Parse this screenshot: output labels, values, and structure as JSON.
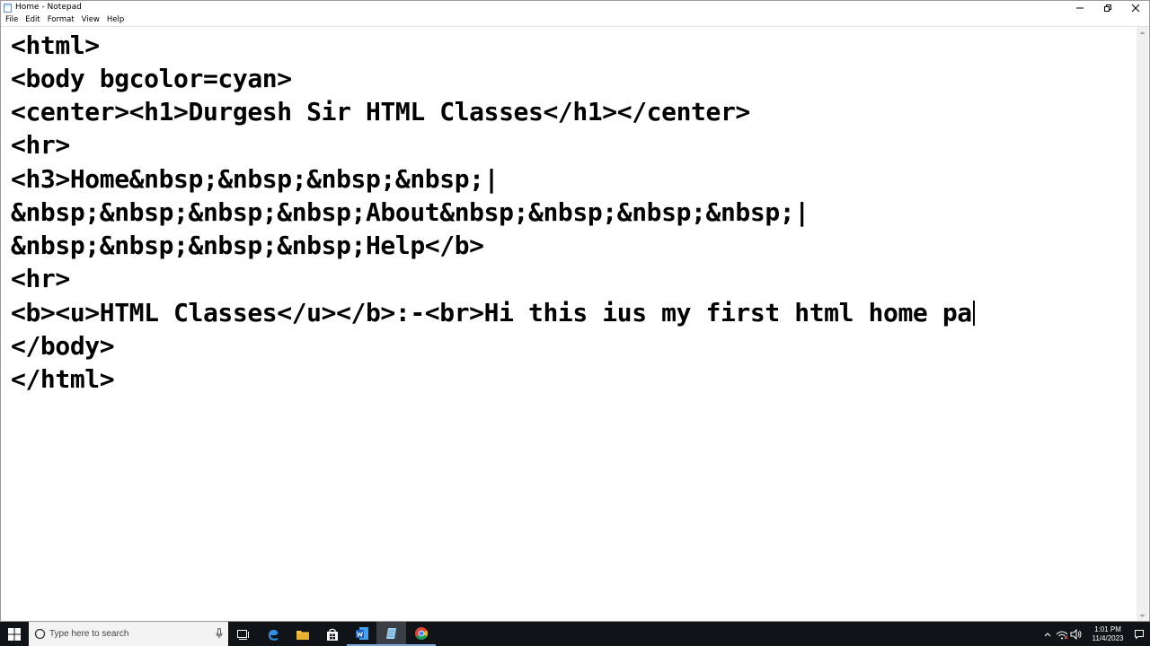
{
  "window": {
    "title": "Home - Notepad"
  },
  "menu": {
    "items": [
      "File",
      "Edit",
      "Format",
      "View",
      "Help"
    ]
  },
  "editor": {
    "lines": [
      "<html>",
      "<body bgcolor=cyan>",
      "<center><h1>Durgesh Sir HTML Classes</h1></center>",
      "<hr>",
      "<h3>Home&nbsp;&nbsp;&nbsp;&nbsp;|",
      "&nbsp;&nbsp;&nbsp;&nbsp;About&nbsp;&nbsp;&nbsp;&nbsp;|",
      "&nbsp;&nbsp;&nbsp;&nbsp;Help</b>",
      "<hr>",
      "<b><u>HTML Classes</u></b>:-<br>Hi this ius my first html home pa",
      "</body>",
      "</html>"
    ]
  },
  "taskbar": {
    "search_placeholder": "Type here to search",
    "apps": [
      "task-view-icon",
      "edge-icon",
      "file-explorer-icon",
      "store-icon",
      "word-icon",
      "notepad-icon",
      "chrome-icon"
    ]
  },
  "clock": {
    "time": "1:01 PM",
    "date": "11/4/2023"
  },
  "colors": {
    "taskbar_bg": "#101418",
    "accent": "#7aa7d8"
  }
}
